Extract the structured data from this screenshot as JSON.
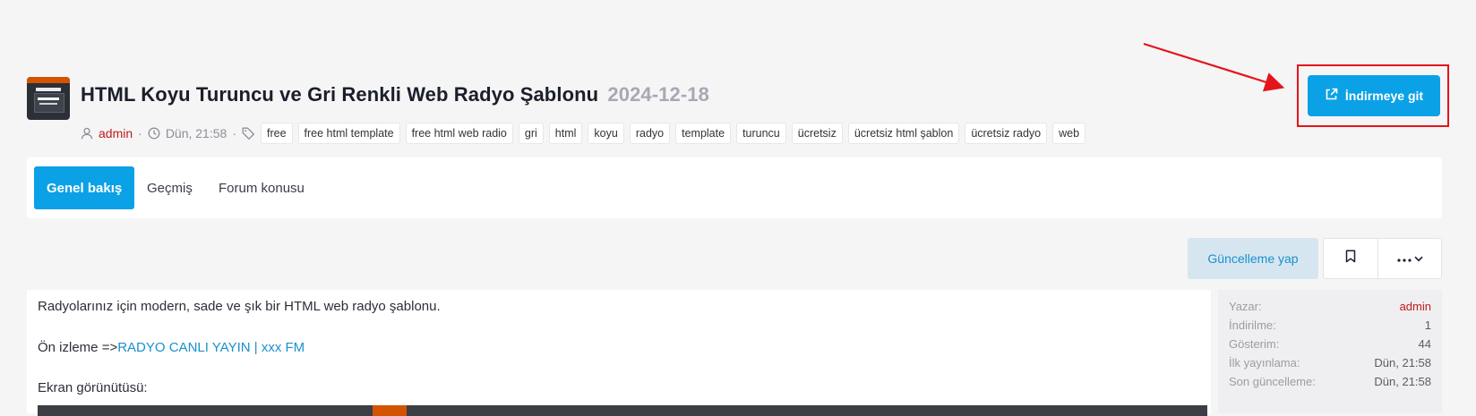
{
  "resource": {
    "title": "HTML Koyu Turuncu ve Gri Renkli Web Radyo Şablonu",
    "version_date": "2024-12-18",
    "author": "admin",
    "posted": "Dün, 21:58",
    "tags": [
      "free",
      "free html template",
      "free html web radio",
      "gri",
      "html",
      "koyu",
      "radyo",
      "template",
      "turuncu",
      "ücretsiz",
      "ücretsiz html şablon",
      "ücretsiz radyo",
      "web"
    ]
  },
  "header": {
    "download_label": "İndirmeye git"
  },
  "tabs": [
    {
      "label": "Genel bakış",
      "active": true
    },
    {
      "label": "Geçmiş",
      "active": false
    },
    {
      "label": "Forum konusu",
      "active": false
    }
  ],
  "actions": {
    "update_label": "Güncelleme yap"
  },
  "body": {
    "line1": "Radyolarınız için modern, sade ve şık bir HTML web radyo şablonu.",
    "preview_prefix": "Ön izleme =>",
    "preview_link": "RADYO CANLI YAYIN | xxx FM",
    "screenshot_label": "Ekran görünütüsü:"
  },
  "sidebar": {
    "rows": [
      {
        "label": "Yazar:",
        "value": "admin"
      },
      {
        "label": "İndirilme:",
        "value": "1"
      },
      {
        "label": "Gösterim:",
        "value": "44"
      },
      {
        "label": "İlk yayınlama:",
        "value": "Dün, 21:58"
      },
      {
        "label": "Son güncelleme:",
        "value": "Dün, 21:58"
      }
    ]
  },
  "colors": {
    "accent": "#0ba1e6",
    "author": "#c01c1c",
    "highlight": "#e4141b",
    "template_orange": "#d35400"
  }
}
